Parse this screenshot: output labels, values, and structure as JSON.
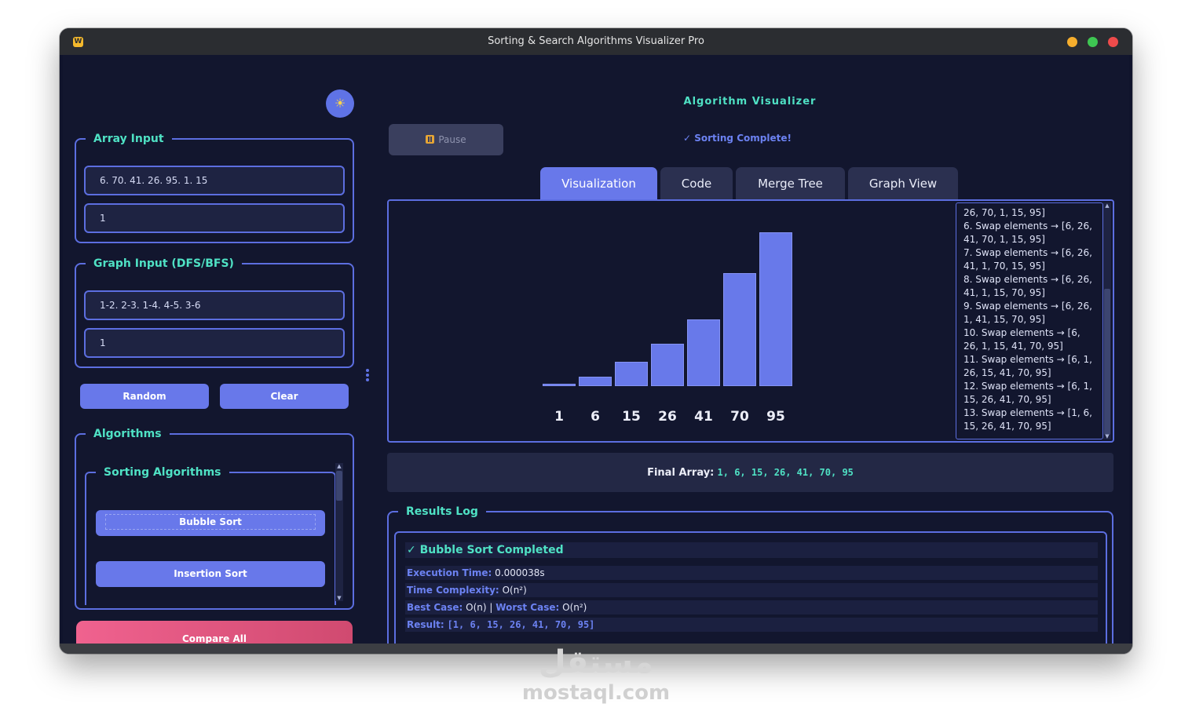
{
  "window": {
    "title": "Sorting & Search Algorithms Visualizer Pro",
    "app_icon_letter": "W"
  },
  "left": {
    "theme_icon": "sun-icon",
    "array_input": {
      "title": "Array Input",
      "array_value": "6. 70. 41. 26. 95. 1. 15",
      "target_value": "1"
    },
    "graph_input": {
      "title": "Graph Input (DFS/BFS)",
      "edges_value": "1-2. 2-3. 1-4. 4-5. 3-6",
      "start_value": "1"
    },
    "random_label": "Random",
    "clear_label": "Clear",
    "algorithms": {
      "title": "Algorithms",
      "sorting_title": "Sorting Algorithms",
      "items": [
        "Bubble Sort",
        "Insertion Sort"
      ]
    },
    "compare_label": "Compare All"
  },
  "main": {
    "title": "Algorithm Visualizer",
    "pause_label": "Pause",
    "status": "✓ Sorting Complete!",
    "tabs": [
      "Visualization",
      "Code",
      "Merge Tree",
      "Graph View"
    ],
    "active_tab": "Visualization",
    "steps": [
      "26, 70, 1, 15, 95]",
      "6. Swap elements → [6, 26, 41, 70, 1, 15, 95]",
      "7. Swap elements → [6, 26, 41, 1, 70, 15, 95]",
      "8. Swap elements → [6, 26, 41, 1, 15, 70, 95]",
      "9. Swap elements → [6, 26, 1, 41, 15, 70, 95]",
      "10. Swap elements → [6, 26, 1, 15, 41, 70, 95]",
      "11. Swap elements → [6, 1, 26, 15, 41, 70, 95]",
      "12. Swap elements → [6, 1, 15, 26, 41, 70, 95]",
      "13. Swap elements → [1, 6, 15, 26, 41, 70, 95]"
    ],
    "final_label": "Final Array:",
    "final_value": "1, 6, 15, 26, 41, 70, 95",
    "results": {
      "title": "Results Log",
      "heading": "✓ Bubble Sort Completed",
      "exec_label": "Execution Time:",
      "exec_value": "0.000038s",
      "time_label": "Time Complexity:",
      "time_value": "O(n²)",
      "best_label": "Best Case:",
      "best_value": "O(n)",
      "sep": "|",
      "worst_label": "Worst Case:",
      "worst_value": "O(n²)",
      "result_label": "Result:",
      "result_value": "[1, 6, 15, 26, 41, 70, 95]"
    }
  },
  "chart_data": {
    "type": "bar",
    "categories": [
      "1",
      "6",
      "15",
      "26",
      "41",
      "70",
      "95"
    ],
    "values": [
      1,
      6,
      15,
      26,
      41,
      70,
      95
    ],
    "ylim": [
      0,
      95
    ],
    "grid": false,
    "color": "#6879ea"
  },
  "watermark": {
    "latin": "mostaql.com",
    "arabic": "مستقل"
  }
}
